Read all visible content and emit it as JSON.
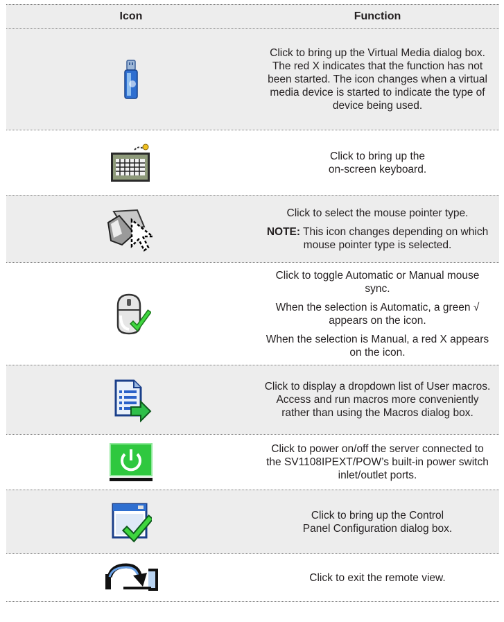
{
  "header": {
    "icon": "Icon",
    "function": "Function"
  },
  "rows": [
    {
      "icon": "usb-drive-icon",
      "desc": "Click to bring up the Virtual Media dialog box. The red X indicates  that the function has not been started. The icon changes when a  virtual media device is started to indicate the type of device being used."
    },
    {
      "icon": "keyboard-icon",
      "desc": "Click to bring up the on-screen keyboard."
    },
    {
      "icon": "mouse-pointer-icon",
      "desc": "Click to select the mouse pointer type.",
      "note_label": "NOTE:",
      "note_text": " This icon changes depending on which mouse pointer type is  selected."
    },
    {
      "icon": "mouse-sync-icon",
      "desc": "Click to toggle Automatic or Manual mouse sync.",
      "p2": "When the selection is Automatic, a green √ appears on the icon.",
      "p3": "When the selection is Manual, a red X appears on the icon."
    },
    {
      "icon": "macro-list-icon",
      "desc": "Click to display a dropdown list of User macros. Access and run  macros more conveniently rather than using the Macros dialog box."
    },
    {
      "icon": "power-icon",
      "desc": "Click to power on/off the server connected to the SV1108IPEXT/POW’s built-in power switch inlet/outlet ports."
    },
    {
      "icon": "control-panel-config-icon",
      "desc": "Click to bring up the Control Panel Configuration dialog box."
    },
    {
      "icon": "exit-icon",
      "desc": "Click to exit the remote view."
    }
  ],
  "colors": {
    "shade": "#ededed",
    "green": "#2eb82e",
    "blue": "#1f5fbf",
    "text": "#231f20"
  }
}
